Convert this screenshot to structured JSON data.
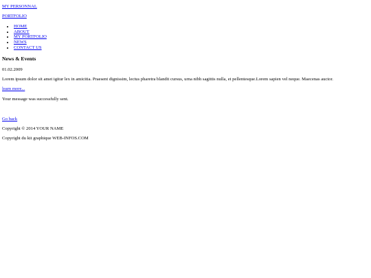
{
  "header": {
    "logo_line1": "MY PERSONNAL",
    "logo_line2": "PORTFOLIO"
  },
  "nav": {
    "items": [
      {
        "label": "HOME"
      },
      {
        "label": "ABOUT"
      },
      {
        "label": "MY PORTFOLIO"
      },
      {
        "label": "NEWS"
      },
      {
        "label": "CONTACT US"
      }
    ]
  },
  "news": {
    "heading": "News & Events",
    "date": "01.02.2009",
    "body": "Lorem ipsum dolor sit amet igitur lex in amicitia. Praesent dignissim, lectus pharetra blandit cursus, urna nibh sagittis nulla, et pellentesque.Lorem sapien vel neque. Maecenas auctor.",
    "learn_more": "learn more..."
  },
  "status": {
    "message": "Your message was successfully sent."
  },
  "footer": {
    "go_back": "Go back",
    "copyright": "Copyright © 2014 YOUR NAME",
    "kit_credit": "Copyright du kit graphique WEB-INFOS.COM"
  },
  "colors": {
    "link": "#0000ee",
    "text": "#000000",
    "background": "#ffffff"
  }
}
